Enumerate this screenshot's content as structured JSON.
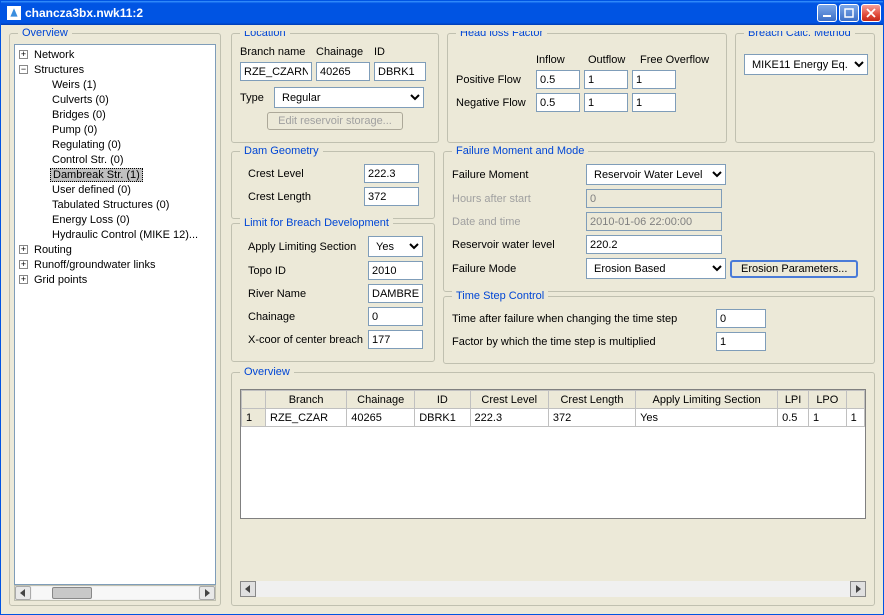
{
  "window": {
    "title": "chancza3bx.nwk11:2"
  },
  "tree": {
    "header": "Overview",
    "items": [
      {
        "label": "Network",
        "depth": 0,
        "toggle": "+"
      },
      {
        "label": "Structures",
        "depth": 0,
        "toggle": "-"
      },
      {
        "label": "Weirs (1)",
        "depth": 1,
        "toggle": ""
      },
      {
        "label": "Culverts (0)",
        "depth": 1,
        "toggle": ""
      },
      {
        "label": "Bridges (0)",
        "depth": 1,
        "toggle": ""
      },
      {
        "label": "Pump (0)",
        "depth": 1,
        "toggle": ""
      },
      {
        "label": "Regulating (0)",
        "depth": 1,
        "toggle": ""
      },
      {
        "label": "Control Str. (0)",
        "depth": 1,
        "toggle": ""
      },
      {
        "label": "Dambreak Str. (1)",
        "depth": 1,
        "toggle": "",
        "selected": true
      },
      {
        "label": "User defined (0)",
        "depth": 1,
        "toggle": ""
      },
      {
        "label": "Tabulated Structures (0)",
        "depth": 1,
        "toggle": ""
      },
      {
        "label": "Energy Loss (0)",
        "depth": 1,
        "toggle": ""
      },
      {
        "label": "Hydraulic Control (MIKE 12)...",
        "depth": 1,
        "toggle": ""
      },
      {
        "label": "Routing",
        "depth": 0,
        "toggle": "+"
      },
      {
        "label": "Runoff/groundwater links",
        "depth": 0,
        "toggle": "+"
      },
      {
        "label": "Grid points",
        "depth": 0,
        "toggle": "+"
      }
    ]
  },
  "location": {
    "legend": "Location",
    "branch_label": "Branch name",
    "chainage_label": "Chainage",
    "id_label": "ID",
    "branch": "RZE_CZARN",
    "chainage": "40265",
    "id": "DBRK1",
    "type_label": "Type",
    "type_value": "Regular",
    "edit_reservoir": "Edit reservoir storage..."
  },
  "headloss": {
    "legend": "Head loss Factor",
    "inflow": "Inflow",
    "outflow": "Outflow",
    "free": "Free Overflow",
    "positive": "Positive Flow",
    "negative": "Negative Flow",
    "pos_in": "0.5",
    "pos_out": "1",
    "pos_free": "1",
    "neg_in": "0.5",
    "neg_out": "1",
    "neg_free": "1"
  },
  "breachcalc": {
    "legend": "Breach Calc. Method",
    "value": "MIKE11 Energy Eq."
  },
  "damgeom": {
    "legend": "Dam Geometry",
    "crest_level_label": "Crest Level",
    "crest_level": "222.3",
    "crest_length_label": "Crest Length",
    "crest_length": "372"
  },
  "limit": {
    "legend": "Limit for Breach Development",
    "apply_label": "Apply Limiting Section",
    "apply_value": "Yes",
    "topo_label": "Topo ID",
    "topo": "2010",
    "river_label": "River Name",
    "river": "DAMBREA",
    "chainage_label": "Chainage",
    "chainage": "0",
    "xcoor_label": "X-coor of center breach",
    "xcoor": "177"
  },
  "failure": {
    "legend": "Failure Moment and Mode",
    "moment_label": "Failure Moment",
    "moment_value": "Reservoir Water Level",
    "hours_label": "Hours after start",
    "hours": "0",
    "date_label": "Date and time",
    "date": "2010-01-06 22:00:00",
    "reservoir_label": "Reservoir water level",
    "reservoir": "220.2",
    "mode_label": "Failure Mode",
    "mode_value": "Erosion Based",
    "erosion_btn": "Erosion Parameters..."
  },
  "timestep": {
    "legend": "Time Step Control",
    "time_after_label": "Time after failure when changing the time step",
    "time_after": "0",
    "factor_label": "Factor by which the time step is multiplied",
    "factor": "1"
  },
  "overview": {
    "legend": "Overview",
    "headers": [
      "Branch",
      "Chainage",
      "ID",
      "Crest Level",
      "Crest Length",
      "Apply Limiting Section",
      "LPI",
      "LPO",
      ""
    ],
    "row_num": "1",
    "row": [
      "RZE_CZAR",
      "40265",
      "DBRK1",
      "222.3",
      "372",
      "Yes",
      "0.5",
      "1",
      "1"
    ]
  }
}
